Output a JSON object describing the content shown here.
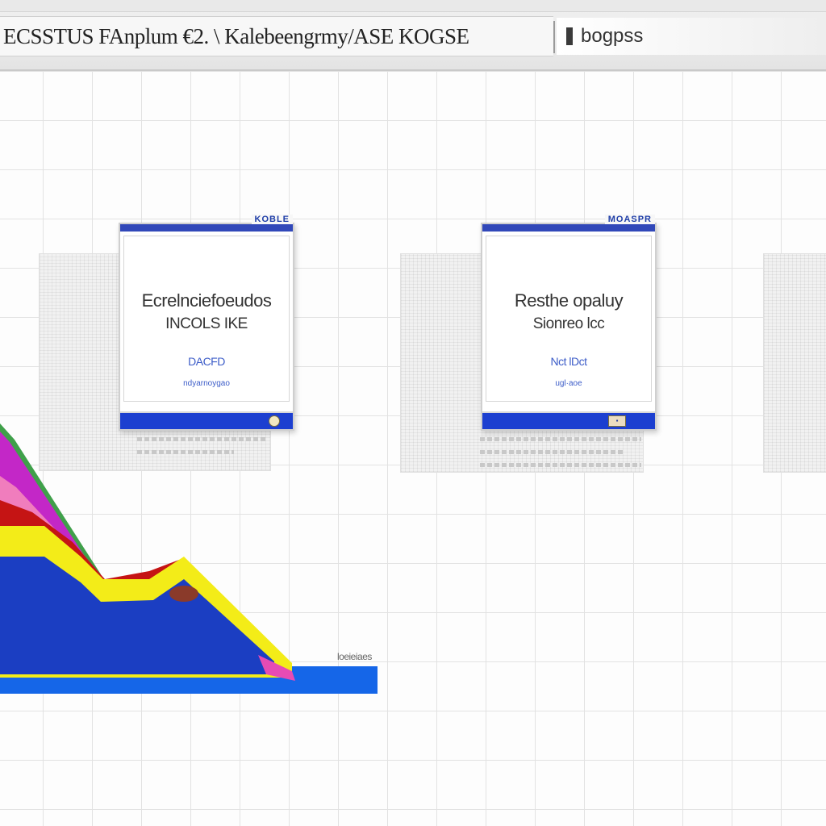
{
  "window": {
    "title": "ECSSTUS FAnplum €2. \\ Kalebeengrmy/ASE KOGSE",
    "side_field": "bogpss"
  },
  "cards": [
    {
      "tab": "KOBLE",
      "line1": "Ecrelnciefoeudos",
      "line2": "INCOLS  IKE",
      "line3": "DACFD",
      "line4": "ndyarnoygao"
    },
    {
      "tab": "MOASPR",
      "line1": "Resthe opaluy",
      "line2": "Sionreo  lcc",
      "line3": "Nct  lDct",
      "line4": "ugl·aoe"
    }
  ],
  "chart_data": {
    "type": "area",
    "caption": "loeieiaes",
    "colors": {
      "blue": "#1b3ec2",
      "bright_blue": "#1566e8",
      "yellow": "#f3ec18",
      "red": "#c51414",
      "magenta": "#c327c7",
      "green": "#3fa04a",
      "pink": "#f07dbd"
    }
  }
}
